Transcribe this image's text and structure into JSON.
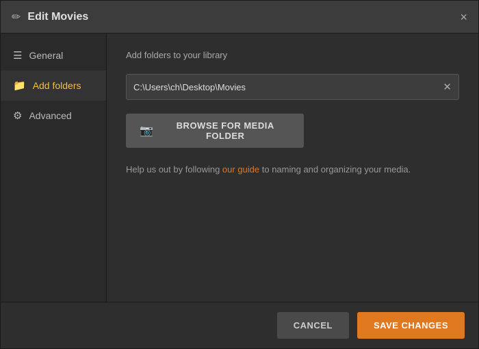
{
  "dialog": {
    "title": "Edit Movies",
    "close_label": "×"
  },
  "sidebar": {
    "items": [
      {
        "id": "general",
        "label": "General",
        "icon": "☰",
        "active": false
      },
      {
        "id": "add-folders",
        "label": "Add folders",
        "icon": "📁",
        "active": true
      },
      {
        "id": "advanced",
        "label": "Advanced",
        "icon": "⚙",
        "active": false
      }
    ]
  },
  "content": {
    "section_label": "Add folders to your library",
    "folder_path": "C:\\Users\\ch\\Desktop\\Movies",
    "browse_button_label": "BROWSE FOR MEDIA FOLDER",
    "guide_text_before": "Help us out by following ",
    "guide_link_text": "our guide",
    "guide_text_after": " to naming and organizing your media."
  },
  "footer": {
    "cancel_label": "CANCEL",
    "save_label": "SAVE CHANGES"
  }
}
